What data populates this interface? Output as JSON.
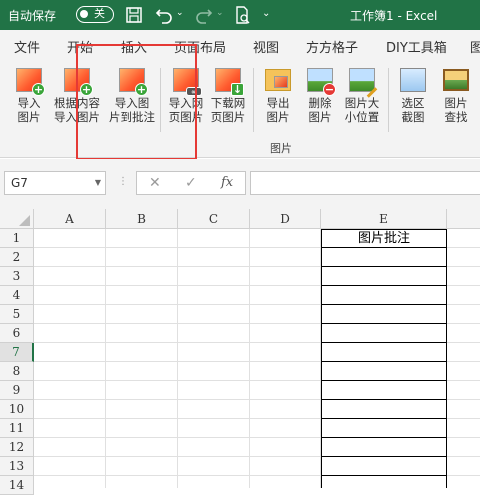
{
  "titlebar": {
    "autosave_label": "自动保存",
    "toggle_state": "关",
    "workbook_title": "工作簿1  -  Excel",
    "color": "#217346"
  },
  "tabs": [
    "文件",
    "开始",
    "插入",
    "页面布局",
    "视图",
    "方方格子",
    "DIY工具箱",
    "图"
  ],
  "ribbon": {
    "group_label": "图片",
    "buttons": [
      {
        "line1": "导入",
        "line2": "图片",
        "icon": "import-picture-icon"
      },
      {
        "line1": "根据内容",
        "line2": "导入图片",
        "icon": "import-by-content-icon"
      },
      {
        "line1": "导入图",
        "line2": "片到批注",
        "icon": "import-to-comment-icon"
      },
      {
        "line1": "导入网",
        "line2": "页图片",
        "icon": "import-web-picture-icon"
      },
      {
        "line1": "下载网",
        "line2": "页图片",
        "icon": "download-web-picture-icon"
      },
      {
        "line1": "导出",
        "line2": "图片",
        "icon": "export-picture-icon"
      },
      {
        "line1": "删除",
        "line2": "图片",
        "icon": "delete-picture-icon"
      },
      {
        "line1": "图片大",
        "line2": "小位置",
        "icon": "picture-size-icon"
      },
      {
        "line1": "选区",
        "line2": "截图",
        "icon": "screenshot-icon"
      },
      {
        "line1": "图片",
        "line2": "查找",
        "icon": "find-picture-icon"
      }
    ]
  },
  "formula_bar": {
    "name_box": "G7",
    "cancel": "✕",
    "enter": "✓",
    "fx": "fx",
    "value": ""
  },
  "grid": {
    "columns": [
      "A",
      "B",
      "C",
      "D",
      "E"
    ],
    "rows": [
      "1",
      "2",
      "3",
      "4",
      "5",
      "6",
      "7",
      "8",
      "9",
      "10",
      "11",
      "12",
      "13",
      "14"
    ],
    "selected_row": "7",
    "e1_value": "图片批注"
  }
}
